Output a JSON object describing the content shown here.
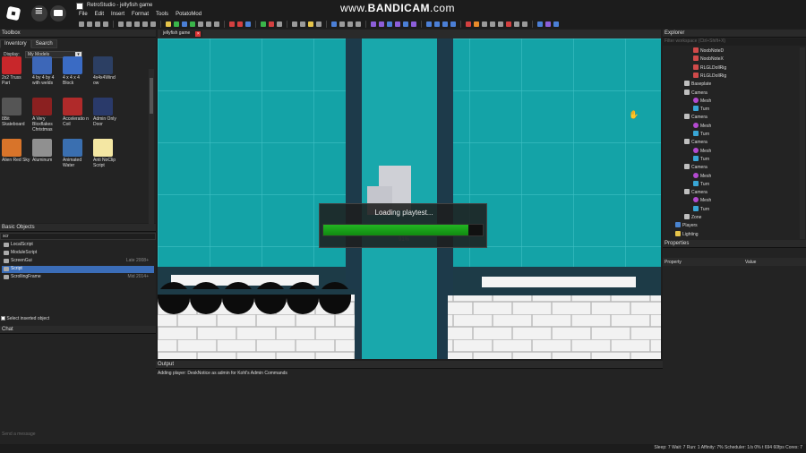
{
  "title_bar": {
    "app_title": "RetroStudio - jellyfish game"
  },
  "watermark": {
    "prefix": "www.",
    "brand": "BANDICAM",
    "suffix": ".com"
  },
  "menu": [
    "File",
    "Edit",
    "Insert",
    "Format",
    "Tools",
    "PotatoMod"
  ],
  "toolbox": {
    "header": "Toolbox",
    "tabs": [
      "Inventory",
      "Search"
    ],
    "display_label": "Display:",
    "display_value": "My Models",
    "items": [
      {
        "label": "2x2 Truss Part",
        "color": "#c8272b"
      },
      {
        "label": "4 by 4 by 4 with welds",
        "color": "#3d67b8"
      },
      {
        "label": "4 x 4 x 4 Block",
        "color": "#3a6bc4"
      },
      {
        "label": "4x4x4Wind ow",
        "color": "#2c3f63"
      },
      {
        "label": "8Bit Skateboard",
        "color": "#555555"
      },
      {
        "label": "A Very Bloxflakes Christmas",
        "color": "#8b2020"
      },
      {
        "label": "Acceleratio n Coil",
        "color": "#b02a2a"
      },
      {
        "label": "Admin Only Door",
        "color": "#2a3a6a"
      },
      {
        "label": "Alien Red Sky",
        "color": "#d8742a"
      },
      {
        "label": "Aluminum",
        "color": "#909090"
      },
      {
        "label": "Animated Water",
        "color": "#3a6fb0"
      },
      {
        "label": "Anti NoClip Script",
        "color": "#f4e7a3"
      }
    ]
  },
  "basic_objects": {
    "header": "Basic Objects",
    "search_value": "scr",
    "items": [
      {
        "label": "LocalScript",
        "meta": ""
      },
      {
        "label": "ModuleScript",
        "meta": ""
      },
      {
        "label": "ScreenGui",
        "meta": "Late 2008+"
      },
      {
        "label": "Script",
        "meta": ""
      },
      {
        "label": "ScrollingFrame",
        "meta": "Mid 2014+"
      }
    ],
    "select_inserted_label": "Select inserted object"
  },
  "chat": {
    "header": "Chat",
    "placeholder": "Send a message"
  },
  "doc_tab": {
    "label": "jellyfish game"
  },
  "loading": {
    "message": "Loading playtest...",
    "percent_label": "91%",
    "progress": 0.91
  },
  "output": {
    "header": "Output",
    "lines": [
      "Adding player: DeskNotice as admin for Kohl's Admin Commands"
    ]
  },
  "explorer": {
    "header": "Explorer",
    "filter_placeholder": "Filter workspace (Ctrl+Shift+X)",
    "rows": [
      {
        "label": "NoobNoteD",
        "icon": "model",
        "level": 2
      },
      {
        "label": "NoobNoteX",
        "icon": "model",
        "level": 2
      },
      {
        "label": "RLGLDollRig",
        "icon": "model",
        "level": 2
      },
      {
        "label": "RLGLDollRig",
        "icon": "model",
        "level": 2
      },
      {
        "label": "Baseplate",
        "icon": "part",
        "level": 1
      },
      {
        "label": "Camera",
        "icon": "part",
        "level": 1
      },
      {
        "label": "Mesh",
        "icon": "mesh",
        "level": 2
      },
      {
        "label": "Turn",
        "icon": "script",
        "level": 2
      },
      {
        "label": "Camera",
        "icon": "part",
        "level": 1
      },
      {
        "label": "Mesh",
        "icon": "mesh",
        "level": 2
      },
      {
        "label": "Turn",
        "icon": "script",
        "level": 2
      },
      {
        "label": "Camera",
        "icon": "part",
        "level": 1
      },
      {
        "label": "Mesh",
        "icon": "mesh",
        "level": 2
      },
      {
        "label": "Turn",
        "icon": "script",
        "level": 2
      },
      {
        "label": "Camera",
        "icon": "part",
        "level": 1
      },
      {
        "label": "Mesh",
        "icon": "mesh",
        "level": 2
      },
      {
        "label": "Turn",
        "icon": "script",
        "level": 2
      },
      {
        "label": "Camera",
        "icon": "part",
        "level": 1
      },
      {
        "label": "Mesh",
        "icon": "mesh",
        "level": 2
      },
      {
        "label": "Turn",
        "icon": "script",
        "level": 2
      },
      {
        "label": "Zone",
        "icon": "part",
        "level": 1
      },
      {
        "label": "Players",
        "icon": "players",
        "level": 0
      },
      {
        "label": "Lighting",
        "icon": "lighting",
        "level": 0
      }
    ]
  },
  "properties": {
    "header": "Properties",
    "col_property": "Property",
    "col_value": "Value"
  },
  "status": {
    "text": "Sleep: 7 Wait: 7 Run: 1 Affinity: 7% Scheduler: 1/s 0%    t 694  60fps  Cores: 7"
  },
  "colors": {
    "viewport_bg": "#13a4a8",
    "selection": "#3b6db8",
    "progress": "#22b522"
  }
}
